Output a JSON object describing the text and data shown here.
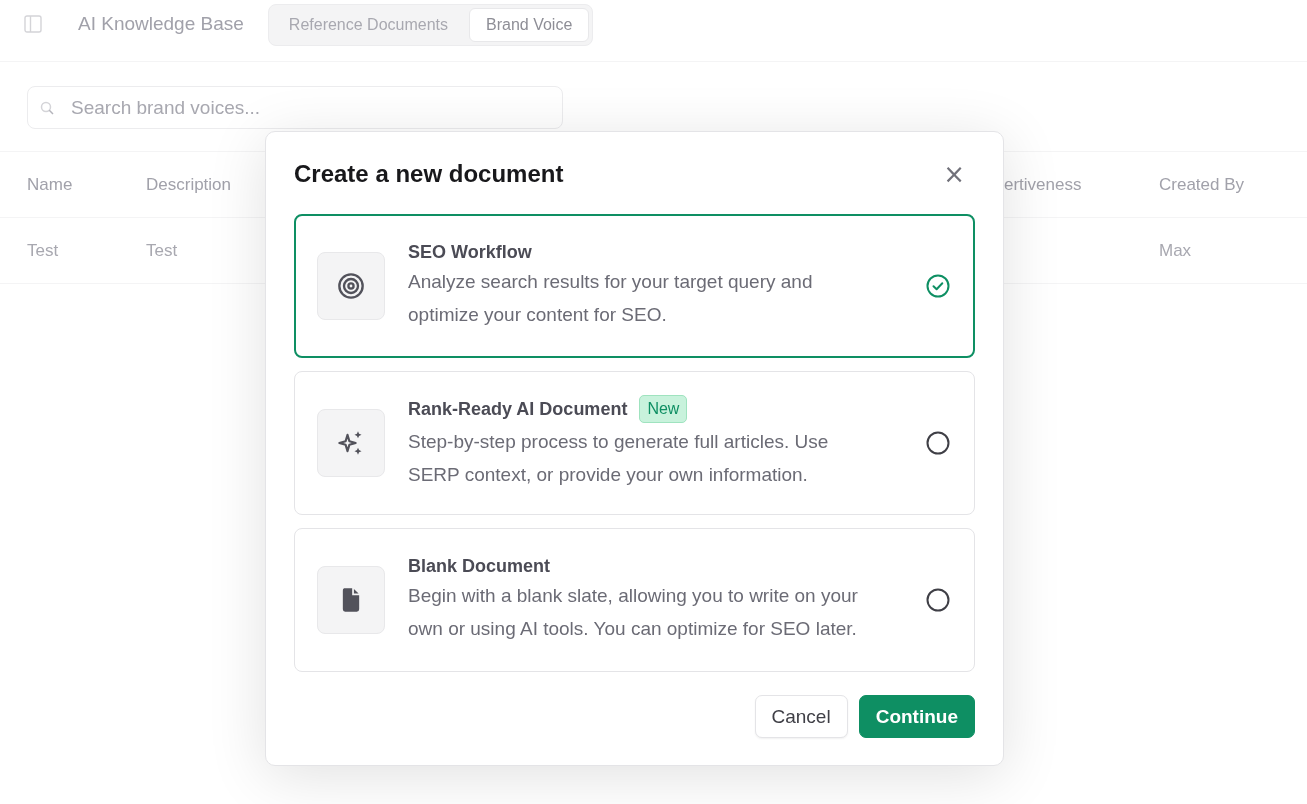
{
  "header": {
    "title": "AI Knowledge Base",
    "tabs": [
      {
        "label": "Reference Documents",
        "selected": false
      },
      {
        "label": "Brand Voice",
        "selected": true
      }
    ]
  },
  "search": {
    "placeholder": "Search brand voices..."
  },
  "table": {
    "columns": [
      "Name",
      "Description",
      "",
      "ertiveness",
      "Created By"
    ],
    "rows": [
      [
        "Test",
        "Test",
        "",
        "",
        "Max"
      ]
    ]
  },
  "dialog": {
    "title": "Create a new document",
    "close": "×",
    "options": [
      {
        "kind": "target",
        "title": "SEO Workflow",
        "description": "Analyze search results for your target query and optimize your content for SEO.",
        "selected": true
      },
      {
        "kind": "sparkles",
        "title": "Rank-Ready AI Document",
        "badge": "New",
        "description": "Step-by-step process to generate full articles. Use SERP context, or provide your own information.",
        "selected": false
      },
      {
        "kind": "file",
        "title": "Blank Document",
        "description": "Begin with a blank slate, allowing you to write on your own or using AI tools. You can optimize for SEO later.",
        "selected": false
      }
    ],
    "buttons": [
      {
        "kind": "secondary",
        "label": "Cancel"
      },
      {
        "kind": "primary",
        "label": "Continue"
      }
    ]
  }
}
